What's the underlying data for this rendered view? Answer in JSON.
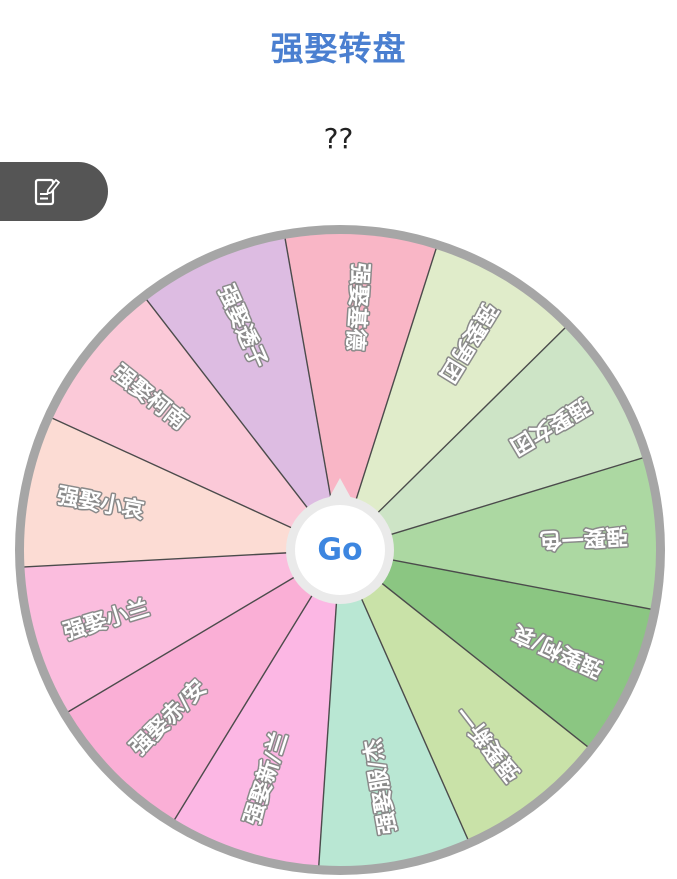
{
  "page": {
    "title": "强娶转盘",
    "result": "??"
  },
  "edit_icon": "edit-note-icon",
  "colors": {
    "title": "#4a7fd0",
    "edit_tab": "#555555",
    "go_text": "#3d86e0",
    "wheel_rim": "#a6a6a6",
    "divider": "#4b4b4b"
  },
  "wheel": {
    "go_label": "Go",
    "segments": [
      {
        "label": "强娶基德",
        "color": "#f9b6c6"
      },
      {
        "label": "强娶男团",
        "color": "#e0ecca"
      },
      {
        "label": "强娶女团",
        "color": "#cde4c6"
      },
      {
        "label": "强娶一色",
        "color": "#acd8a2"
      },
      {
        "label": "强娶柯/哀",
        "color": "#8bc682"
      },
      {
        "label": "强娶新一",
        "color": "#c9e2a8"
      },
      {
        "label": "强娶服/杰",
        "color": "#b9e7d3"
      },
      {
        "label": "强娶新/兰",
        "color": "#fcb7e4"
      },
      {
        "label": "强娶赤/安",
        "color": "#faafd6"
      },
      {
        "label": "强娶小兰",
        "color": "#fbbdde"
      },
      {
        "label": "强娶小哀",
        "color": "#fcdcd4"
      },
      {
        "label": "强娶柯南",
        "color": "#fbc9d8"
      },
      {
        "label": "强娶透子",
        "color": "#ddbce2"
      }
    ]
  }
}
